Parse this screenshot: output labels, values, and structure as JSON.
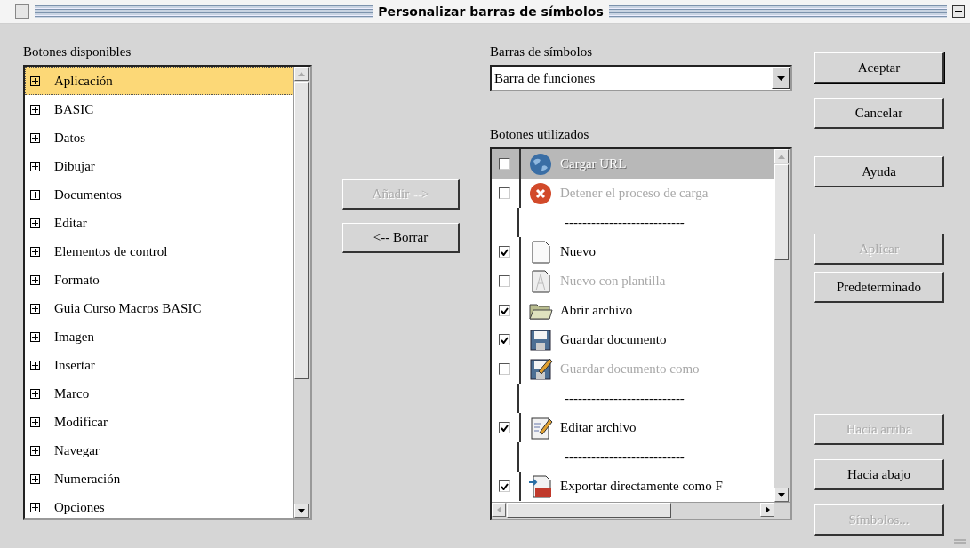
{
  "window": {
    "title": "Personalizar barras de símbolos"
  },
  "available": {
    "label": "Botones disponibles",
    "items": [
      {
        "label": "Aplicación",
        "selected": true
      },
      {
        "label": "BASIC",
        "selected": false
      },
      {
        "label": "Datos",
        "selected": false
      },
      {
        "label": "Dibujar",
        "selected": false
      },
      {
        "label": "Documentos",
        "selected": false
      },
      {
        "label": "Editar",
        "selected": false
      },
      {
        "label": "Elementos de control",
        "selected": false
      },
      {
        "label": "Formato",
        "selected": false
      },
      {
        "label": "Guia Curso Macros BASIC",
        "selected": false
      },
      {
        "label": "Imagen",
        "selected": false
      },
      {
        "label": "Insertar",
        "selected": false
      },
      {
        "label": "Marco",
        "selected": false
      },
      {
        "label": "Modificar",
        "selected": false
      },
      {
        "label": "Navegar",
        "selected": false
      },
      {
        "label": "Numeración",
        "selected": false
      },
      {
        "label": "Opciones",
        "selected": false
      }
    ]
  },
  "middle_buttons": [
    {
      "label": "Añadir -->",
      "disabled": true
    },
    {
      "label": "<-- Borrar",
      "disabled": false
    }
  ],
  "toolbars": {
    "label": "Barras de símbolos",
    "value": "Barra de funciones"
  },
  "used": {
    "label": "Botones utilizados",
    "items": [
      {
        "kind": "item",
        "label": "Cargar URL",
        "checked": false,
        "disabled": true,
        "selected": true
      },
      {
        "kind": "item",
        "label": "Detener el proceso de carga",
        "checked": false,
        "disabled": true,
        "selected": false
      },
      {
        "kind": "separator",
        "label": "---------------------------"
      },
      {
        "kind": "item",
        "label": "Nuevo",
        "checked": true,
        "disabled": false,
        "selected": false
      },
      {
        "kind": "item",
        "label": "Nuevo con plantilla",
        "checked": false,
        "disabled": true,
        "selected": false
      },
      {
        "kind": "item",
        "label": "Abrir archivo",
        "checked": true,
        "disabled": false,
        "selected": false
      },
      {
        "kind": "item",
        "label": "Guardar documento",
        "checked": true,
        "disabled": false,
        "selected": false
      },
      {
        "kind": "item",
        "label": "Guardar documento como",
        "checked": false,
        "disabled": true,
        "selected": false
      },
      {
        "kind": "separator",
        "label": "---------------------------"
      },
      {
        "kind": "item",
        "label": "Editar archivo",
        "checked": true,
        "disabled": false,
        "selected": false
      },
      {
        "kind": "separator",
        "label": "---------------------------"
      },
      {
        "kind": "item",
        "label": "Exportar directamente como F",
        "checked": true,
        "disabled": false,
        "selected": false
      }
    ]
  },
  "side_buttons": [
    {
      "label": "Aceptar",
      "disabled": false,
      "default": true
    },
    {
      "label": "Cancelar",
      "disabled": false,
      "default": false
    },
    {
      "label": "Ayuda",
      "disabled": false,
      "default": false
    },
    {
      "label": "Aplicar",
      "disabled": true,
      "default": false
    },
    {
      "label": "Predeterminado",
      "disabled": false,
      "default": false
    },
    {
      "label": "Hacia arriba",
      "disabled": true,
      "default": false
    },
    {
      "label": "Hacia abajo",
      "disabled": false,
      "default": false
    },
    {
      "label": "Símbolos...",
      "disabled": true,
      "default": false
    }
  ]
}
